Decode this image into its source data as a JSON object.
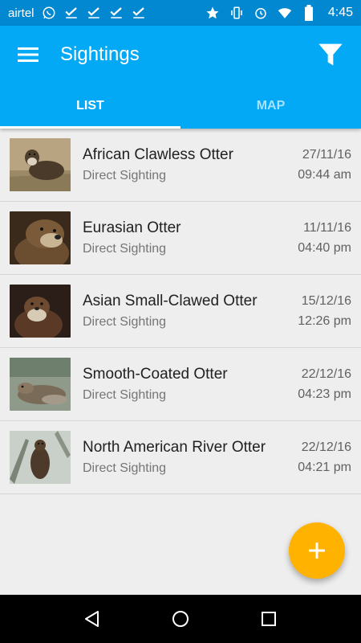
{
  "status_bar": {
    "carrier": "airtel",
    "time": "4:45",
    "icons": [
      "whatsapp-icon",
      "check-icon",
      "check-icon",
      "check-icon",
      "check-icon",
      "star-icon",
      "vibrate-icon",
      "alarm-icon",
      "wifi-icon",
      "battery-icon"
    ]
  },
  "app_bar": {
    "title": "Sightings",
    "menu_icon": "hamburger-menu-icon",
    "filter_icon": "filter-icon"
  },
  "tabs": [
    {
      "label": "LIST",
      "active": true
    },
    {
      "label": "MAP",
      "active": false
    }
  ],
  "sightings": [
    {
      "name": "African Clawless Otter",
      "type": "Direct Sighting",
      "date": "27/11/16",
      "time": "09:44 am",
      "thumb": "otter-photo"
    },
    {
      "name": "Eurasian Otter",
      "type": "Direct Sighting",
      "date": "11/11/16",
      "time": "04:40 pm",
      "thumb": "otter-photo"
    },
    {
      "name": "Asian Small-Clawed Otter",
      "type": "Direct Sighting",
      "date": "15/12/16",
      "time": "12:26 pm",
      "thumb": "otter-photo"
    },
    {
      "name": "Smooth-Coated Otter",
      "type": "Direct Sighting",
      "date": "22/12/16",
      "time": "04:23 pm",
      "thumb": "otter-photo"
    },
    {
      "name": "North American River Otter",
      "type": "Direct Sighting",
      "date": "22/12/16",
      "time": "04:21 pm",
      "thumb": "otter-photo"
    }
  ],
  "fab": {
    "icon": "plus-icon",
    "color": "#ffb300"
  },
  "nav_bar": {
    "icons": [
      "back-icon",
      "home-icon",
      "recents-icon"
    ]
  },
  "colors": {
    "primary": "#03a9f4",
    "primary_dark": "#0288d1",
    "accent": "#ffb300"
  }
}
